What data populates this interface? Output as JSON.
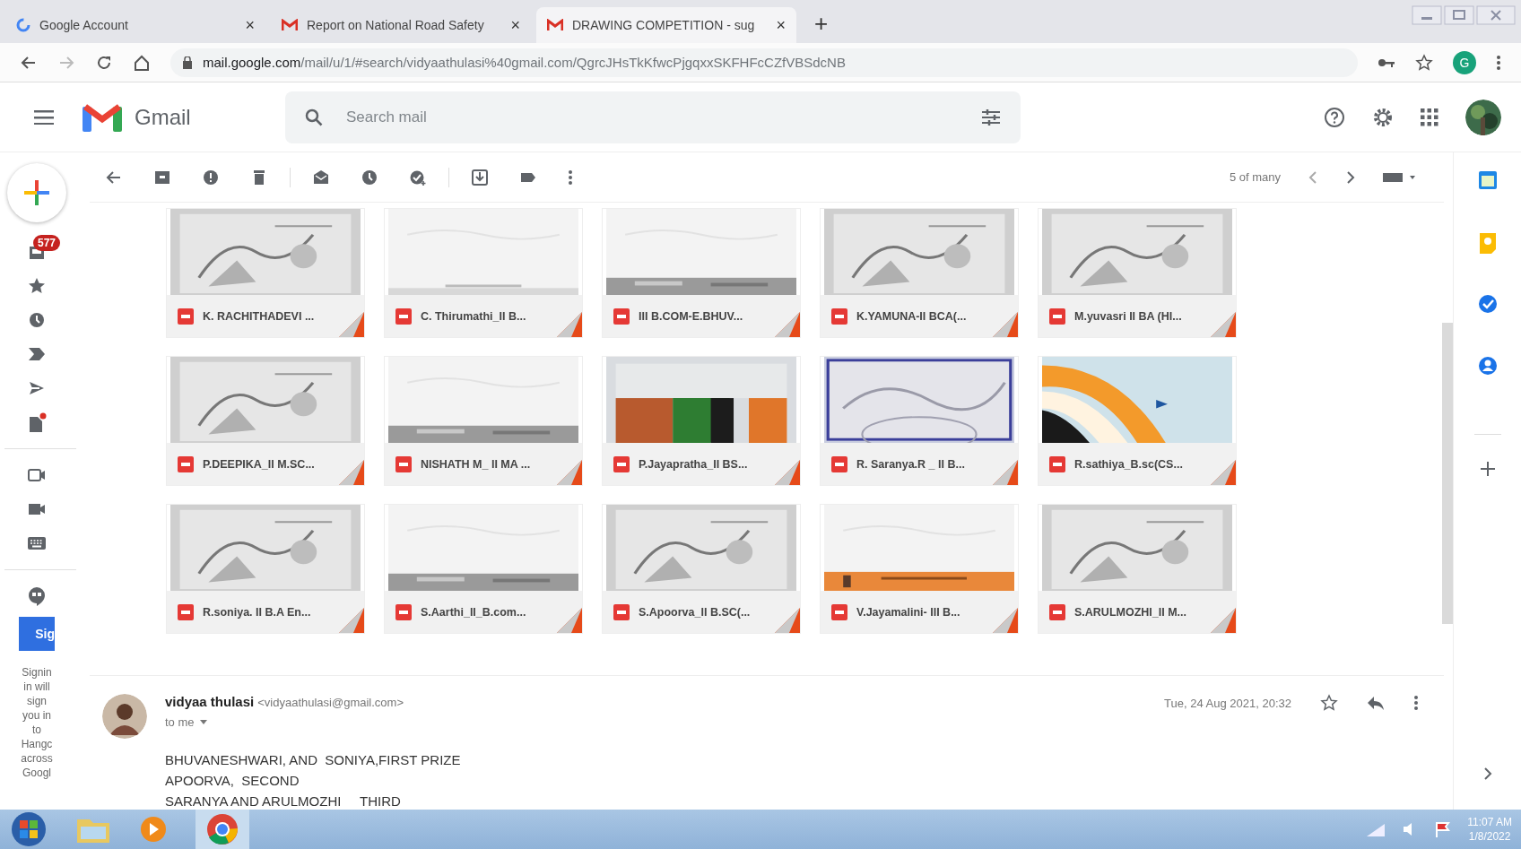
{
  "browser": {
    "tabs": [
      {
        "title": "Google Account",
        "kind": "google",
        "close": "×",
        "selected": false
      },
      {
        "title": "Report on National Road Safety",
        "kind": "gmail",
        "close": "×",
        "selected": false
      },
      {
        "title": "DRAWING COMPETITION - sug",
        "kind": "gmail",
        "close": "×",
        "selected": true
      }
    ],
    "new_tab": "+",
    "address": {
      "host": "mail.google.com",
      "path": "/mail/u/1/#search/vidyaathulasi%40gmail.com/QgrcJHsTkKfwcPjgqxxSKFHFcCZfVBSdcNB"
    },
    "profile_initial": "G"
  },
  "gmail": {
    "product_name": "Gmail",
    "search": {
      "placeholder": "Search mail"
    }
  },
  "rail": {
    "badge": "577",
    "signin_button": "Sig",
    "signin_note": "Signin in will sign you in to Hangc across Googl"
  },
  "toolbar": {
    "pagination": "5 of many"
  },
  "attachments": [
    {
      "name": "K. RACHITHADEVI ..."
    },
    {
      "name": "C. Thirumathi_II B..."
    },
    {
      "name": "III B.COM-E.BHUV..."
    },
    {
      "name": "K.YAMUNA-II BCA(..."
    },
    {
      "name": "M.yuvasri II BA (HI..."
    },
    {
      "name": "P.DEEPIKA_II M.SC..."
    },
    {
      "name": "NISHATH M_ II MA ..."
    },
    {
      "name": "P.Jayapratha_II BS..."
    },
    {
      "name": "R. Saranya.R _ II B..."
    },
    {
      "name": "R.sathiya_B.sc(CS..."
    },
    {
      "name": "R.soniya. II B.A En..."
    },
    {
      "name": "S.Aarthi_II_B.com..."
    },
    {
      "name": "S.Apoorva_II B.SC(..."
    },
    {
      "name": "V.Jayamalini- III B..."
    },
    {
      "name": "S.ARULMOZHI_II M..."
    }
  ],
  "message": {
    "sender": "vidyaa thulasi",
    "email": "<vidyaathulasi@gmail.com>",
    "recipient": "to me",
    "date": "Tue, 24 Aug 2021, 20:32",
    "body": [
      "BHUVANESHWARI, AND  SONIYA,FIRST PRIZE",
      "APOORVA,  SECOND",
      "SARANYA AND ARULMOZHI     THIRD"
    ]
  },
  "taskbar": {
    "time": "11:07 AM",
    "date": "1/8/2022"
  }
}
